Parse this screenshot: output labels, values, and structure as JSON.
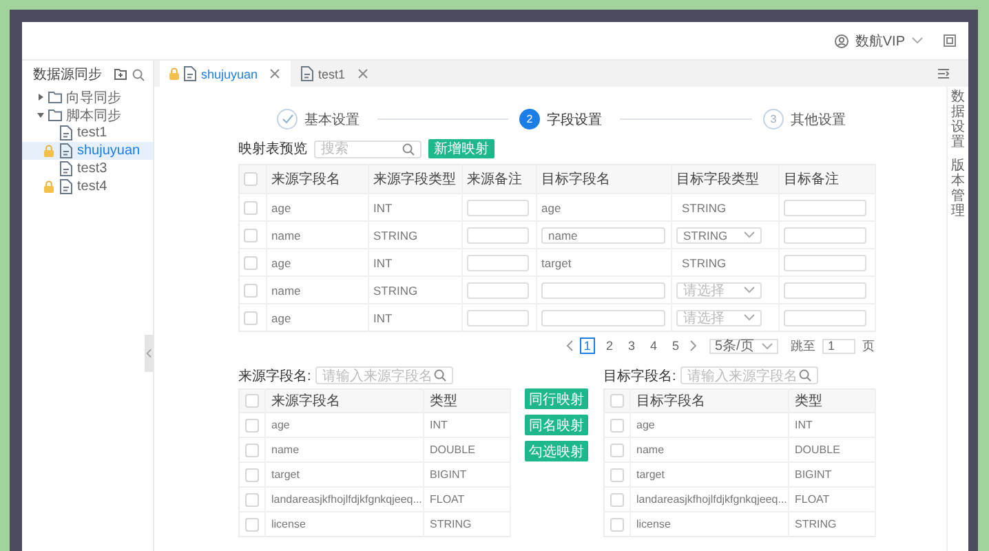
{
  "header": {
    "user": "数航VIP"
  },
  "sidebar": {
    "title": "数据源同步",
    "items": [
      {
        "kind": "folder",
        "label": "向导同步",
        "expanded": false
      },
      {
        "kind": "folder",
        "label": "脚本同步",
        "expanded": true,
        "children": [
          {
            "kind": "file",
            "label": "test1",
            "locked": false,
            "selected": false
          },
          {
            "kind": "file",
            "label": "shujuyuan",
            "locked": true,
            "selected": true
          },
          {
            "kind": "file",
            "label": "test3",
            "locked": false,
            "selected": false
          },
          {
            "kind": "file",
            "label": "test4",
            "locked": true,
            "selected": false
          }
        ]
      }
    ]
  },
  "tabs": [
    {
      "label": "shujuyuan",
      "locked": true,
      "selected": true
    },
    {
      "label": "test1",
      "locked": false,
      "selected": false
    }
  ],
  "side_panel": {
    "items": [
      "数据设置",
      "版本管理"
    ]
  },
  "steps": [
    {
      "label": "基本设置",
      "completed": true,
      "active": false
    },
    {
      "number": "2",
      "label": "字段设置",
      "completed": false,
      "active": true
    },
    {
      "number": "3",
      "label": "其他设置",
      "completed": false,
      "active": false
    }
  ],
  "mapping": {
    "title": "映射表预览",
    "search": {
      "placeholder": "搜索"
    },
    "add_button": "新增映射",
    "all_checked": false,
    "columns": [
      "来源字段名",
      "来源字段类型",
      "来源备注",
      "目标字段名",
      "目标字段类型",
      "目标备注"
    ],
    "rows": [
      {
        "checked": false,
        "source_name": "age",
        "source_type": "INT",
        "target_name": {
          "kind": "text",
          "value": "age"
        },
        "target_type": {
          "kind": "text",
          "value": "STRING"
        }
      },
      {
        "checked": false,
        "source_name": "name",
        "source_type": "STRING",
        "target_name": {
          "kind": "input",
          "value": "name"
        },
        "target_type": {
          "kind": "select",
          "value": "STRING"
        }
      },
      {
        "checked": false,
        "source_name": "age",
        "source_type": "INT",
        "target_name": {
          "kind": "text",
          "value": "target"
        },
        "target_type": {
          "kind": "text",
          "value": "STRING"
        }
      },
      {
        "checked": false,
        "source_name": "name",
        "source_type": "STRING",
        "target_name": {
          "kind": "input"
        },
        "target_type": {
          "kind": "select",
          "placeholder": "请选择"
        }
      },
      {
        "checked": false,
        "source_name": "age",
        "source_type": "INT",
        "target_name": {
          "kind": "input"
        },
        "target_type": {
          "kind": "select",
          "placeholder": "请选择"
        }
      }
    ]
  },
  "pagination": {
    "pages": [
      {
        "label": "1",
        "selected": true
      },
      {
        "label": "2",
        "selected": false
      },
      {
        "label": "3",
        "selected": false
      },
      {
        "label": "4",
        "selected": false
      },
      {
        "label": "5",
        "selected": false
      }
    ],
    "page_size": "5条/页",
    "jump_label": "跳至",
    "jump_value": "1",
    "jump_suffix": "页"
  },
  "transfer": {
    "source": {
      "label": "来源字段名:",
      "placeholder": "请输入来源字段名",
      "all_checked": false,
      "columns": [
        "来源字段名",
        "类型"
      ],
      "rows": [
        {
          "checked": false,
          "name": "age",
          "type": "INT"
        },
        {
          "checked": false,
          "name": "name",
          "type": "DOUBLE"
        },
        {
          "checked": false,
          "name": "target",
          "type": "BIGINT"
        },
        {
          "checked": false,
          "name": "landareasjkfhojlfdjkfgnkqjeeq...",
          "type": "FLOAT"
        },
        {
          "checked": false,
          "name": "license",
          "type": "STRING"
        }
      ]
    },
    "actions": [
      "同行映射",
      "同名映射",
      "勾选映射"
    ],
    "target": {
      "label": "目标字段名:",
      "placeholder": "请输入来源字段名",
      "all_checked": false,
      "columns": [
        "目标字段名",
        "类型"
      ],
      "rows": [
        {
          "checked": false,
          "name": "age",
          "type": "INT"
        },
        {
          "checked": false,
          "name": "name",
          "type": "DOUBLE"
        },
        {
          "checked": false,
          "name": "target",
          "type": "BIGINT"
        },
        {
          "checked": false,
          "name": "landareasjkfhojlfdjkfgnkqjeeq...",
          "type": "FLOAT"
        },
        {
          "checked": false,
          "name": "license",
          "type": "STRING"
        }
      ]
    }
  }
}
